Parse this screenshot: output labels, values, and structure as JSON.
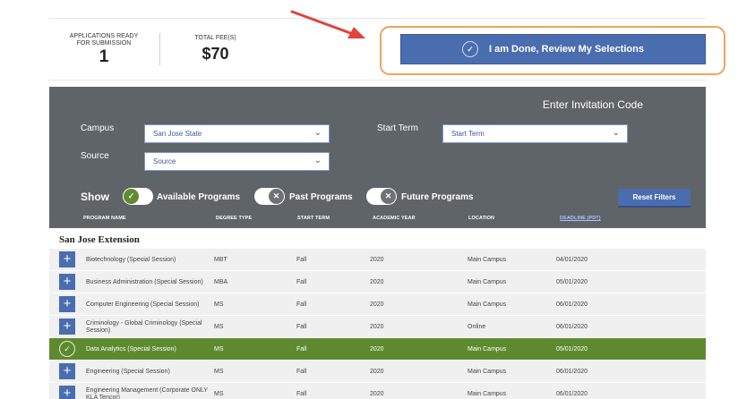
{
  "summary": {
    "apps_label": "APPLICATIONS READY FOR SUBMISSION",
    "apps_value": "1",
    "fee_label": "TOTAL FEE(S)",
    "fee_value": "$70"
  },
  "done_button": {
    "label": "I am Done, Review My Selections",
    "icon": "check-circle-icon"
  },
  "filters": {
    "invite_link": "Enter Invitation Code",
    "campus_label": "Campus",
    "campus_value": "San Jose State",
    "start_term_label": "Start Term",
    "start_term_value": "Start Term",
    "source_label": "Source",
    "source_value": "Source",
    "show_label": "Show",
    "toggles": [
      {
        "label": "Available Programs",
        "on": true
      },
      {
        "label": "Past Programs",
        "on": false
      },
      {
        "label": "Future Programs",
        "on": false
      }
    ],
    "reset_label": "Reset Filters"
  },
  "columns": [
    "PROGRAM NAME",
    "DEGREE TYPE",
    "START TERM",
    "ACADEMIC YEAR",
    "LOCATION",
    "DEADLINE (PDT)"
  ],
  "group_title": "San Jose Extension",
  "rows": [
    {
      "name": "Biotechnology (Special Session)",
      "degree": "MBT",
      "term": "Fall",
      "year": "2020",
      "location": "Main Campus",
      "deadline": "04/01/2020",
      "selected": false
    },
    {
      "name": "Business Administration (Special Session)",
      "degree": "MBA",
      "term": "Fall",
      "year": "2020",
      "location": "Main Campus",
      "deadline": "05/01/2020",
      "selected": false
    },
    {
      "name": "Computer Engineering (Special Session)",
      "degree": "MS",
      "term": "Fall",
      "year": "2020",
      "location": "Main Campus",
      "deadline": "06/01/2020",
      "selected": false
    },
    {
      "name": "Criminology - Global Criminology (Special Session)",
      "degree": "MS",
      "term": "Fall",
      "year": "2020",
      "location": "Online",
      "deadline": "06/01/2020",
      "selected": false
    },
    {
      "name": "Data Analytics (Special Session)",
      "degree": "MS",
      "term": "Fall",
      "year": "2020",
      "location": "Main Campus",
      "deadline": "05/01/2020",
      "selected": true
    },
    {
      "name": "Engineering (Special Session)",
      "degree": "MS",
      "term": "Fall",
      "year": "2020",
      "location": "Main Campus",
      "deadline": "06/01/2020",
      "selected": false
    },
    {
      "name": "Engineering Management (Corporate ONLY KLA Tencor)",
      "degree": "MS",
      "term": "Fall",
      "year": "2020",
      "location": "Main Campus",
      "deadline": "06/01/2020",
      "selected": false
    }
  ],
  "colors": {
    "accent": "#4a6db0",
    "selected_row": "#5d8a2f",
    "panel": "#5f6468",
    "highlight": "#f0a35a",
    "arrow": "#e0443a"
  }
}
